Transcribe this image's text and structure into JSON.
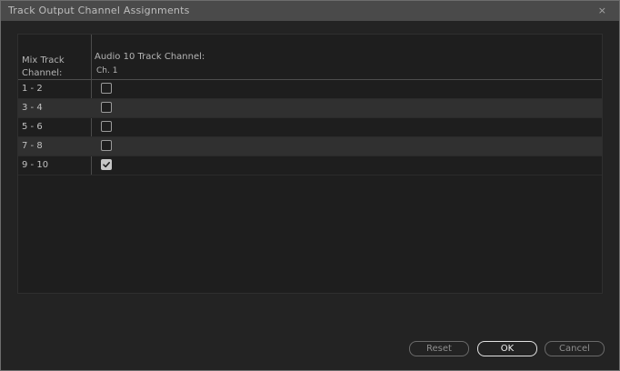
{
  "window": {
    "title": "Track Output Channel Assignments",
    "close_glyph": "×"
  },
  "table": {
    "mix_header": "Mix Track Channel:",
    "audio_header": "Audio 10 Track Channel:",
    "channel_header": "Ch. 1",
    "rows": [
      {
        "label": "1 - 2",
        "checked": false
      },
      {
        "label": "3 - 4",
        "checked": false
      },
      {
        "label": "5 - 6",
        "checked": false
      },
      {
        "label": "7 - 8",
        "checked": false
      },
      {
        "label": "9 - 10",
        "checked": true
      }
    ]
  },
  "buttons": {
    "reset": "Reset",
    "ok": "OK",
    "cancel": "Cancel"
  },
  "icons": {
    "close": "close-icon",
    "check": "check-icon"
  }
}
